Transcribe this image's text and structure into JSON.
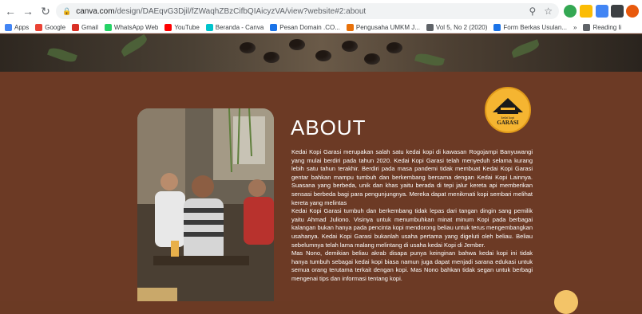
{
  "browser": {
    "url_host": "canva.com",
    "url_path": "/design/DAEqvG3Djil/fZWaqhZBzCifbQIAicyzVA/view?website#2:about"
  },
  "bookmarks": [
    {
      "label": "Apps",
      "color": "#4285f4"
    },
    {
      "label": "Google",
      "color": "#ea4335"
    },
    {
      "label": "Gmail",
      "color": "#d93025"
    },
    {
      "label": "WhatsApp Web",
      "color": "#25d366"
    },
    {
      "label": "YouTube",
      "color": "#ff0000"
    },
    {
      "label": "Beranda - Canva",
      "color": "#00c4cc"
    },
    {
      "label": "Pesan Domain .CO...",
      "color": "#1a73e8"
    },
    {
      "label": "Pengusaha UMKM J...",
      "color": "#e8710a"
    },
    {
      "label": "Vol 5, No 2 (2020)",
      "color": "#5f6368"
    },
    {
      "label": "Form Berkas Usulan...",
      "color": "#1a73e8"
    },
    {
      "label": "»",
      "color": ""
    },
    {
      "label": "Reading li",
      "color": "#5f6368"
    }
  ],
  "about": {
    "title": "ABOUT",
    "paragraphs": [
      "Kedai Kopi Garasi merupakan salah satu kedai kopi di kawasan Rogojampi Banyuwangi yang mulai berdiri pada tahun 2020. Kedai Kopi Garasi telah menyeduh selama kurang lebih satu tahun terakhir. Berdiri pada masa pandemi tidak membuat Kedai Kopi Garasi gentar bahkan mampu tumbuh dan berkembang bersama dengan Kedai Kopi Lainnya. Suasana yang berbeda, unik dan khas yaitu berada di tepi jalur kereta api memberikan sensasi berbeda bagi para pengunjungnya. Mereka dapat menikmati kopi sembari melihat kereta yang melintas",
      "Kedai Kopi Garasi tumbuh dan berkembang tidak lepas dari tangan dingin sang pemilik yaitu Ahmad Juliono. Visinya untuk menumbuhkan minat minum Kopi pada berbagai kalangan bukan hanya pada pencinta kopi mendorong beliau untuk terus mengembangkan usahanya. Kedai Kopi Garasi bukanlah usaha pertama yang digeluti oleh beliau. Beliau sebelumnya telah lama malang melintang di usaha kedai Kopi di Jember.",
      "Mas Nono, demikian beliau akrab disapa punya keinginan bahwa kedai kopi ini tidak hanya tumbuh sebagai kedai kopi biasa namun juga dapat menjadi sarana edukasi untuk semua orang terutama terkait dengan kopi. Mas Nono bahkan tidak segan untuk berbagi mengenai tips dan informasi tentang kopi."
    ],
    "logo_text": "GARASI",
    "logo_subtext": "kedai kopi"
  },
  "colors": {
    "page_background": "#6c3a25",
    "logo_yellow": "#f5b531"
  }
}
